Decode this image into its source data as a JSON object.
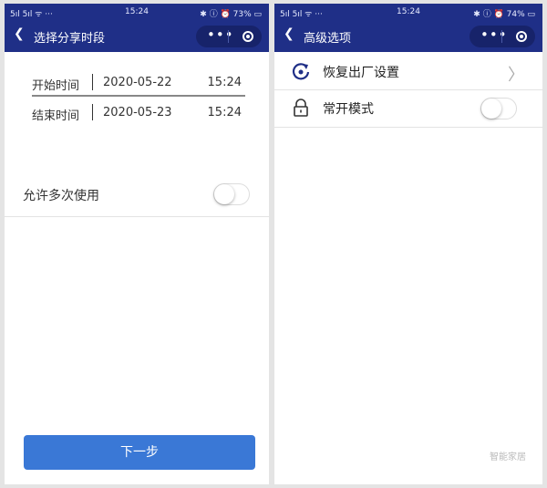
{
  "screen1": {
    "status": {
      "left": "5ıl 5ıl ᯤ ···",
      "time": "15:24",
      "right": "✱ ⓘ ⏰ 73% ▭"
    },
    "nav": {
      "title": "选择分享时段",
      "more": "•••"
    },
    "start": {
      "label": "开始时间",
      "date": "2020-05-22",
      "time": "15:24"
    },
    "end": {
      "label": "结束时间",
      "date": "2020-05-23",
      "time": "15:24"
    },
    "allow_multi": {
      "label": "允许多次使用",
      "enabled": false
    },
    "next_label": "下一步"
  },
  "screen2": {
    "status": {
      "left": "5ıl 5ıl ᯤ ···",
      "time": "15:24",
      "right": "✱ ⓘ ⏰ 74% ▭"
    },
    "nav": {
      "title": "高级选项",
      "more": "•••"
    },
    "items": [
      {
        "label": "恢复出厂设置",
        "icon": "reset-icon",
        "type": "link"
      },
      {
        "label": "常开模式",
        "icon": "lock-icon",
        "type": "toggle",
        "enabled": false
      }
    ]
  },
  "watermark": "智能家居",
  "colors": {
    "header": "#1f2f87",
    "button": "#3a78d6"
  }
}
